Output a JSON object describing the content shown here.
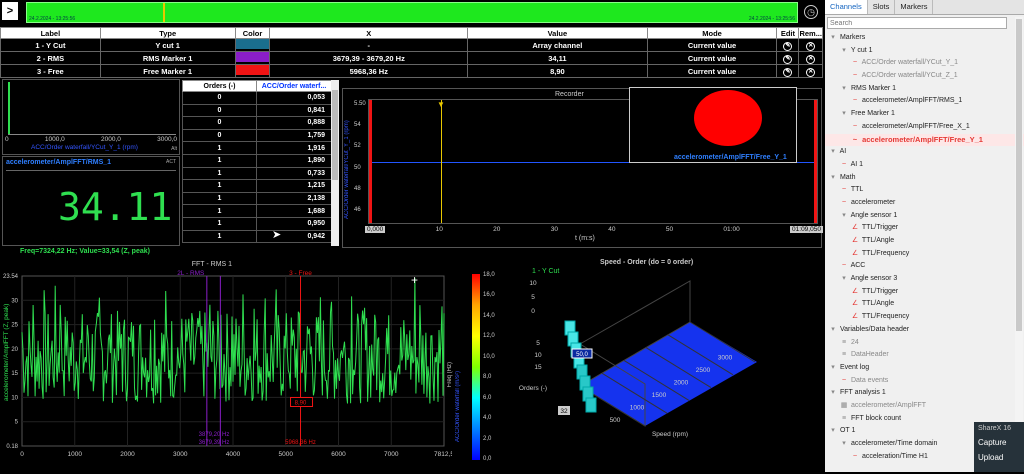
{
  "topbar": {
    "expand": ">",
    "ts_left": "24.2.2024 - 13:25:56",
    "ts_right": "24.2.2024 - 13:25:56",
    "clock_icon": "clock-icon"
  },
  "markers_table": {
    "headers": [
      "Label",
      "Type",
      "Color",
      "X",
      "Value",
      "Mode",
      "Edit",
      "Rem..."
    ],
    "rows": [
      {
        "label": "1 - Y Cut",
        "type": "Y cut 1",
        "color": "#1a6e8e",
        "x": "-",
        "value": "Array channel",
        "mode": "Current value"
      },
      {
        "label": "2 - RMS",
        "type": "RMS Marker 1",
        "color": "#8a1ec8",
        "x": "3679,39 - 3679,20 Hz",
        "value": "34,11",
        "mode": "Current value"
      },
      {
        "label": "3 - Free",
        "type": "Free Marker 1",
        "color": "#f01414",
        "x": "5968,36 Hz",
        "value": "8,90",
        "mode": "Current value"
      }
    ]
  },
  "small_chart": {
    "ylabel": "ACC/Order waterfall/YCut_Y_1 (rpm)",
    "ticks": [
      "0",
      "1000,0",
      "2000,0",
      "3000,0"
    ],
    "act": "Alt"
  },
  "digital": {
    "title": "accelerometer/AmplFFT/RMS_1",
    "act": "ACT",
    "value": "34.11"
  },
  "orders": {
    "h1": "Orders (-)",
    "h2": "ACC/Order waterf...",
    "rows": [
      [
        "0",
        "0,053"
      ],
      [
        "0",
        "0,841"
      ],
      [
        "0",
        "0,888"
      ],
      [
        "0",
        "1,759"
      ],
      [
        "1",
        "1,916"
      ],
      [
        "1",
        "1,890"
      ],
      [
        "1",
        "0,733"
      ],
      [
        "1",
        "1,215"
      ],
      [
        "1",
        "2,138"
      ],
      [
        "1",
        "1,688"
      ],
      [
        "1",
        "0,950"
      ],
      [
        "1",
        "0,942"
      ]
    ]
  },
  "recorder": {
    "title": "Recorder",
    "ylabel": "ACC/Order waterfall/YCut_Y_1 (rpm)",
    "yticks": [
      "5.50",
      "54",
      "52",
      "50",
      "48",
      "46"
    ],
    "xticks": [
      "0,000",
      "10",
      "20",
      "30",
      "40",
      "50",
      "01:00",
      "01:09,050"
    ],
    "xlabel": "t (m:s)",
    "overlay_label": "accelerometer/AmplFFT/Free_Y_1"
  },
  "fft": {
    "readout": "Freq=7324,22 Hz; Value=33,54  (Z, peak)",
    "title": "FFT - RMS 1",
    "ylabel": "accelerometer/AmplFFT (Z, peak)",
    "xticks": [
      "0",
      "1000",
      "2000",
      "3000",
      "4000",
      "5000",
      "6000",
      "7000",
      "7812,5"
    ],
    "yticks": [
      "23.54",
      "30",
      "25",
      "20",
      "15",
      "10",
      "5",
      "0.18"
    ],
    "m2": "2L - RMS",
    "m3": "3 - Free",
    "v3": "8,90",
    "f1": "3879,20 Hz",
    "f2": "3679,39 Hz",
    "f3": "5968,36 Hz"
  },
  "colorbar": {
    "label": "ACC/Order waterfall (m/s²)",
    "ticks": [
      "18,0",
      "16,0",
      "14,0",
      "12,0",
      "10,0",
      "8,0",
      "6,0",
      "4,0",
      "2,0",
      "0,0"
    ],
    "freq": "Freq (Hz)"
  },
  "waterfall": {
    "title": "Speed - Order (do = 0 order)",
    "ycut": "1 - Y Cut",
    "value_label": "50,0",
    "zticks": [
      "10",
      "5",
      "0"
    ],
    "order_ticks": [
      "5",
      "10",
      "15"
    ],
    "order_label": "Orders (-)",
    "order_min": "32",
    "speed_ticks": [
      "500",
      "1000",
      "1500",
      "2000",
      "2500",
      "3000"
    ],
    "speed_label": "Speed (rpm)"
  },
  "sidebar": {
    "tabs": [
      "Channels",
      "Slots",
      "Markers"
    ],
    "search_placeholder": "Search",
    "tree": [
      {
        "t": "Markers",
        "lvl": 0,
        "ic": "▾"
      },
      {
        "t": "Y cut 1",
        "lvl": 1,
        "ic": "▾"
      },
      {
        "t": "ACC/Order waterfall/YCut_Y_1",
        "lvl": 2,
        "ic": "~",
        "dim": true
      },
      {
        "t": "ACC/Order waterfall/YCut_Z_1",
        "lvl": 2,
        "ic": "~",
        "dim": true
      },
      {
        "t": "RMS Marker 1",
        "lvl": 1,
        "ic": "▾"
      },
      {
        "t": "accelerometer/AmplFFT/RMS_1",
        "lvl": 2,
        "ic": "~"
      },
      {
        "t": "Free Marker 1",
        "lvl": 1,
        "ic": "▾"
      },
      {
        "t": "accelerometer/AmplFFT/Free_X_1",
        "lvl": 2,
        "ic": "~"
      },
      {
        "t": "accelerometer/AmplFFT/Free_Y_1",
        "lvl": 2,
        "ic": "~",
        "sel": true
      },
      {
        "t": "AI",
        "lvl": 0,
        "ic": "▾"
      },
      {
        "t": "AI 1",
        "lvl": 1,
        "ic": "~"
      },
      {
        "t": "Math",
        "lvl": 0,
        "ic": "▾"
      },
      {
        "t": "TTL",
        "lvl": 1,
        "ic": "~"
      },
      {
        "t": "accelerometer",
        "lvl": 1,
        "ic": "~"
      },
      {
        "t": "Angle sensor 1",
        "lvl": 1,
        "ic": "▾"
      },
      {
        "t": "TTL/Trigger",
        "lvl": 2,
        "ic": "∠"
      },
      {
        "t": "TTL/Angle",
        "lvl": 2,
        "ic": "∠"
      },
      {
        "t": "TTL/Frequency",
        "lvl": 2,
        "ic": "∠"
      },
      {
        "t": "ACC",
        "lvl": 1,
        "ic": "~"
      },
      {
        "t": "Angle sensor 3",
        "lvl": 1,
        "ic": "▾"
      },
      {
        "t": "TTL/Trigger",
        "lvl": 2,
        "ic": "∠"
      },
      {
        "t": "TTL/Angle",
        "lvl": 2,
        "ic": "∠"
      },
      {
        "t": "TTL/Frequency",
        "lvl": 2,
        "ic": "∠"
      },
      {
        "t": "Variables/Data header",
        "lvl": 0,
        "ic": "▾"
      },
      {
        "t": "24",
        "lvl": 1,
        "ic": "≡",
        "dim": true
      },
      {
        "t": "DataHeader",
        "lvl": 1,
        "ic": "≡",
        "dim": true
      },
      {
        "t": "Event log",
        "lvl": 0,
        "ic": "▾"
      },
      {
        "t": "Data events",
        "lvl": 1,
        "ic": "~",
        "dim": true
      },
      {
        "t": "FFT analysis 1",
        "lvl": 0,
        "ic": "▾"
      },
      {
        "t": "accelerometer/AmplFFT",
        "lvl": 1,
        "ic": "▦",
        "dim": true
      },
      {
        "t": "FFT block count",
        "lvl": 1,
        "ic": "≡"
      },
      {
        "t": "OT 1",
        "lvl": 0,
        "ic": "▾"
      },
      {
        "t": "accelerometer/Time domain",
        "lvl": 1,
        "ic": "▾"
      },
      {
        "t": "acceleration/Time H1",
        "lvl": 2,
        "ic": "~"
      }
    ]
  },
  "sharex": {
    "title": "ShareX 16",
    "capture": "Capture",
    "upload": "Upload"
  }
}
